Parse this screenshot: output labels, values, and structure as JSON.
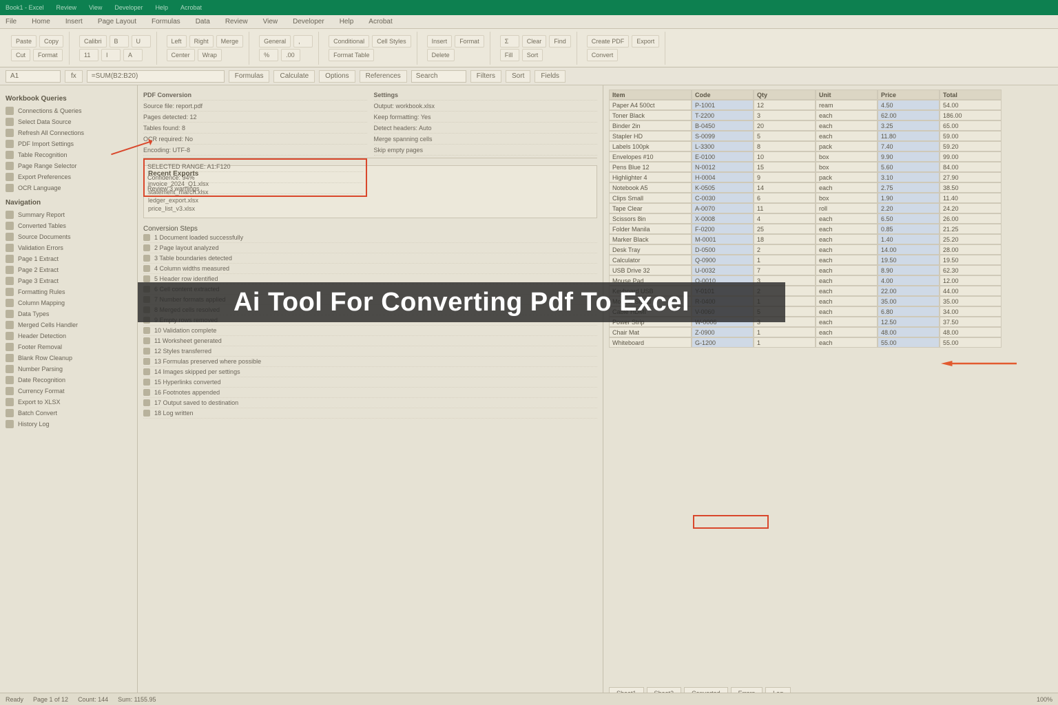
{
  "overlay_title": "Ai Tool For Converting Pdf To Excel",
  "titlebar": {
    "segments": [
      "Book1 - Excel",
      "Review",
      "View",
      "Developer",
      "Help",
      "Acrobat"
    ]
  },
  "menubar": {
    "items": [
      "File",
      "Home",
      "Insert",
      "Page Layout",
      "Formulas",
      "Data",
      "Review",
      "View",
      "Developer",
      "Help",
      "Acrobat"
    ]
  },
  "ribbon": {
    "groups": [
      {
        "name": "clipboard",
        "buttons": [
          "Paste",
          "Cut",
          "Copy",
          "Format"
        ]
      },
      {
        "name": "font",
        "buttons": [
          "Calibri",
          "11",
          "B",
          "I",
          "U",
          "A"
        ]
      },
      {
        "name": "alignment",
        "buttons": [
          "Left",
          "Center",
          "Right",
          "Wrap",
          "Merge"
        ]
      },
      {
        "name": "number",
        "buttons": [
          "General",
          "%",
          ",",
          ".00"
        ]
      },
      {
        "name": "styles",
        "buttons": [
          "Conditional",
          "Format Table",
          "Cell Styles"
        ]
      },
      {
        "name": "cells",
        "buttons": [
          "Insert",
          "Delete",
          "Format"
        ]
      },
      {
        "name": "editing",
        "buttons": [
          "Σ",
          "Fill",
          "Clear",
          "Sort",
          "Find"
        ]
      },
      {
        "name": "pdf",
        "buttons": [
          "Create PDF",
          "Convert",
          "Export"
        ]
      }
    ]
  },
  "toolbar2": {
    "namebox": "A1",
    "items": [
      "fx",
      "=SUM(B2:B20)",
      "Formulas",
      "Calculate",
      "Options",
      "References",
      "Search",
      "Filters",
      "Sort",
      "Fields"
    ]
  },
  "sidebar": {
    "header1": "Workbook Queries",
    "items1": [
      "Connections & Queries",
      "Select Data Source",
      "Refresh All Connections",
      "PDF Import Settings",
      "Table Recognition",
      "Page Range Selector",
      "Export Preferences",
      "OCR Language"
    ],
    "header2": "Navigation",
    "items2": [
      "Summary Report",
      "Converted Tables",
      "Source Documents",
      "Validation Errors",
      "Page 1 Extract",
      "Page 2 Extract",
      "Page 3 Extract",
      "Formatting Rules",
      "Column Mapping",
      "Data Types",
      "Merged Cells Handler",
      "Header Detection",
      "Footer Removal",
      "Blank Row Cleanup",
      "Number Parsing",
      "Date Recognition",
      "Currency Format",
      "Export to XLSX",
      "Batch Convert",
      "History Log"
    ]
  },
  "midtop": {
    "headerA": "PDF Conversion",
    "headerB": "Settings",
    "rowsA": [
      "Source file: report.pdf",
      "Pages detected: 12",
      "Tables found: 8",
      "OCR required: No",
      "Encoding: UTF-8"
    ],
    "rowsB": [
      "Output: workbook.xlsx",
      "Keep formatting: Yes",
      "Detect headers: Auto",
      "Merge spanning cells",
      "Skip empty pages"
    ],
    "highlighted": [
      "SELECTED RANGE: A1:F120",
      "Confidence: 94%",
      "Review 3 warnings"
    ]
  },
  "panel": {
    "header": "Recent Exports",
    "lines": [
      "invoice_2024_Q1.xlsx",
      "statement_march.xlsx",
      "ledger_export.xlsx",
      "price_list_v3.xlsx"
    ]
  },
  "midlist": {
    "header": "Conversion Steps",
    "items": [
      "1 Document loaded successfully",
      "2 Page layout analyzed",
      "3 Table boundaries detected",
      "4 Column widths measured",
      "5 Header row identified",
      "6 Cell content extracted",
      "7 Number formats applied",
      "8 Merged cells resolved",
      "9 Empty rows removed",
      "10 Validation complete",
      "11 Worksheet generated",
      "12 Styles transferred",
      "13 Formulas preserved where possible",
      "14 Images skipped per settings",
      "15 Hyperlinks converted",
      "16 Footnotes appended",
      "17 Output saved to destination",
      "18 Log written"
    ]
  },
  "sheet": {
    "headers": [
      "Item",
      "Code",
      "Qty",
      "Unit",
      "Price",
      "Total"
    ],
    "rows": [
      [
        "Paper A4 500ct",
        "P-1001",
        "12",
        "ream",
        "4.50",
        "54.00"
      ],
      [
        "Toner Black",
        "T-2200",
        "3",
        "each",
        "62.00",
        "186.00"
      ],
      [
        "Binder 2in",
        "B-0450",
        "20",
        "each",
        "3.25",
        "65.00"
      ],
      [
        "Stapler HD",
        "S-0099",
        "5",
        "each",
        "11.80",
        "59.00"
      ],
      [
        "Labels 100pk",
        "L-3300",
        "8",
        "pack",
        "7.40",
        "59.20"
      ],
      [
        "Envelopes #10",
        "E-0100",
        "10",
        "box",
        "9.90",
        "99.00"
      ],
      [
        "Pens Blue 12",
        "N-0012",
        "15",
        "box",
        "5.60",
        "84.00"
      ],
      [
        "Highlighter 4",
        "H-0004",
        "9",
        "pack",
        "3.10",
        "27.90"
      ],
      [
        "Notebook A5",
        "K-0505",
        "14",
        "each",
        "2.75",
        "38.50"
      ],
      [
        "Clips Small",
        "C-0030",
        "6",
        "box",
        "1.90",
        "11.40"
      ],
      [
        "Tape Clear",
        "A-0070",
        "11",
        "roll",
        "2.20",
        "24.20"
      ],
      [
        "Scissors 8in",
        "X-0008",
        "4",
        "each",
        "6.50",
        "26.00"
      ],
      [
        "Folder Manila",
        "F-0200",
        "25",
        "each",
        "0.85",
        "21.25"
      ],
      [
        "Marker Black",
        "M-0001",
        "18",
        "each",
        "1.40",
        "25.20"
      ],
      [
        "Desk Tray",
        "D-0500",
        "2",
        "each",
        "14.00",
        "28.00"
      ],
      [
        "Calculator",
        "Q-0900",
        "1",
        "each",
        "19.50",
        "19.50"
      ],
      [
        "USB Drive 32",
        "U-0032",
        "7",
        "each",
        "8.90",
        "62.30"
      ],
      [
        "Mouse Pad",
        "O-0010",
        "3",
        "each",
        "4.00",
        "12.00"
      ],
      [
        "Keyboard USB",
        "Y-0101",
        "2",
        "each",
        "22.00",
        "44.00"
      ],
      [
        "Monitor Stand",
        "R-0400",
        "1",
        "each",
        "35.00",
        "35.00"
      ],
      [
        "Cable HDMI",
        "V-0060",
        "5",
        "each",
        "6.80",
        "34.00"
      ],
      [
        "Power Strip",
        "W-0006",
        "3",
        "each",
        "12.50",
        "37.50"
      ],
      [
        "Chair Mat",
        "Z-0900",
        "1",
        "each",
        "48.00",
        "48.00"
      ],
      [
        "Whiteboard",
        "G-1200",
        "1",
        "each",
        "55.00",
        "55.00"
      ]
    ]
  },
  "tabs": [
    "Sheet1",
    "Sheet2",
    "Converted",
    "Errors",
    "Log"
  ],
  "statusbar": {
    "items": [
      "Ready",
      "Page 1 of 12",
      "Count: 144",
      "Sum: 1155.95",
      "100%"
    ]
  }
}
